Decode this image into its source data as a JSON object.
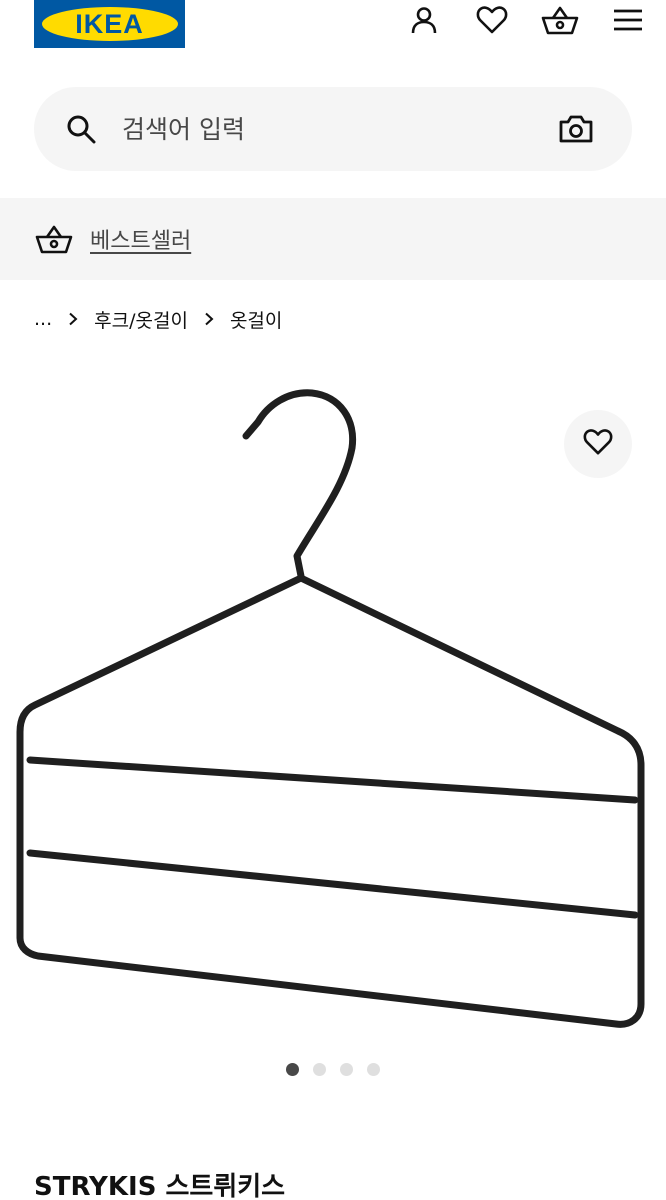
{
  "header": {
    "logo_text": "IKEA",
    "icons": [
      "user-icon",
      "heart-icon",
      "basket-icon",
      "menu-icon"
    ]
  },
  "search": {
    "placeholder": "검색어 입력",
    "value": "",
    "left_icon": "search-icon",
    "right_icon": "camera-icon"
  },
  "banner": {
    "icon": "basket-icon",
    "label": "베스트셀러"
  },
  "breadcrumb": {
    "items": [
      "...",
      "후크/옷걸이",
      "옷걸이"
    ],
    "separator_icon": "chevron-right-icon"
  },
  "product": {
    "image": "clothes-hanger",
    "favorite_icon": "heart-icon",
    "name": "STRYKIS",
    "name_local": "스트뤼키스"
  },
  "carousel": {
    "total": 4,
    "active_index": 0
  },
  "colors": {
    "brand_blue": "#0058a3",
    "brand_yellow": "#ffdb00",
    "surface": "#f5f5f5",
    "text": "#111111",
    "muted_text": "#484848",
    "dot_active": "#484848",
    "dot_inactive": "#dfdfdf",
    "hanger": "#1f1f1f"
  }
}
